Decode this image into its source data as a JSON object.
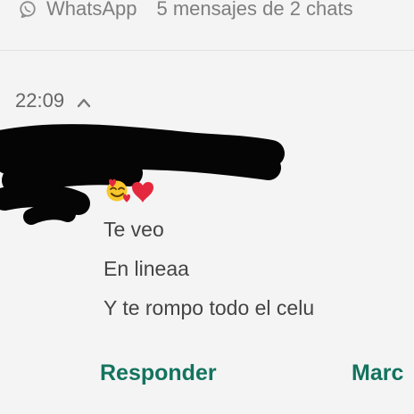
{
  "notification": {
    "app_name": "WhatsApp",
    "summary": "5 mensajes de 2 chats",
    "time": "22:09",
    "icons": {
      "app": "whatsapp-icon",
      "expand": "chevron-up-icon",
      "emoji": "smiling-face-with-hearts-emoji",
      "heart": "red-heart-emoji"
    },
    "messages": [
      "Te veo",
      "En lineaa",
      "Y te rompo todo el celu"
    ],
    "actions": {
      "reply": "Responder",
      "mark": "Marc"
    },
    "colors": {
      "action_green": "#13735f",
      "muted_gray": "#7e7e7e",
      "text_gray": "#444444",
      "heart_red": "#e4283e",
      "emoji_yellow": "#f7c72d"
    }
  }
}
